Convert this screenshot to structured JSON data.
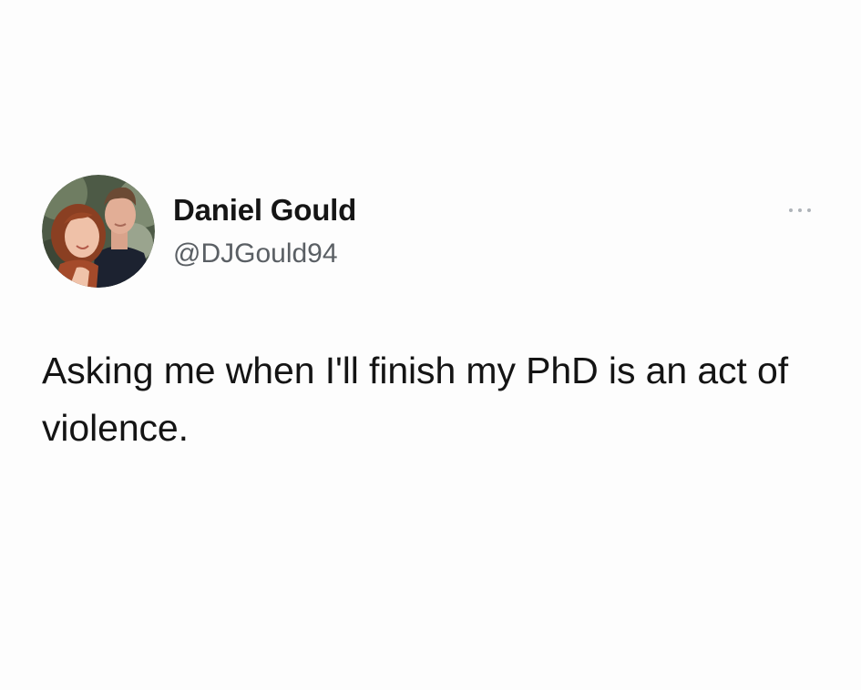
{
  "tweet": {
    "author": {
      "display_name": "Daniel Gould",
      "handle": "@DJGould94",
      "avatar_icon": "profile-photo-avatar"
    },
    "menu_icon": "more-options-icon",
    "text": "Asking me when I'll finish my PhD is an act of violence."
  },
  "colors": {
    "background": "#fdfdfd",
    "text": "#141414",
    "handle": "#5a5f64",
    "menu_dots": "#aeb3b8"
  }
}
